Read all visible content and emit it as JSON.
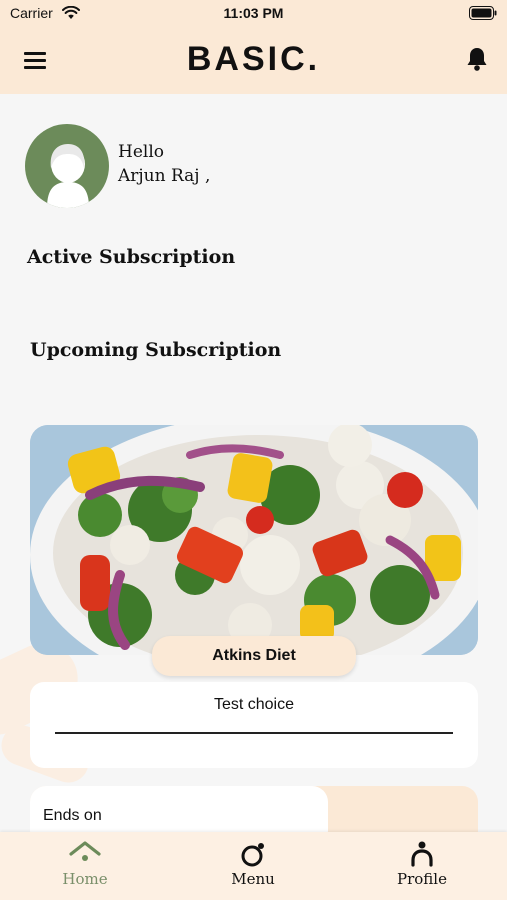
{
  "status_bar": {
    "carrier": "Carrier",
    "time": "11:03 PM"
  },
  "header": {
    "logo": "BASIC."
  },
  "greeting": {
    "hello": "Hello",
    "name": "Arjun Raj ,"
  },
  "sections": {
    "active": "Active Subscription",
    "upcoming": "Upcoming Subscription"
  },
  "subscription": {
    "diet_name": "Atkins Diet",
    "choice": "Test choice",
    "ends_label": "Ends on"
  },
  "tabs": [
    {
      "label": "Home",
      "icon": "home-icon",
      "active": true
    },
    {
      "label": "Menu",
      "icon": "menu-icon",
      "active": false
    },
    {
      "label": "Profile",
      "icon": "profile-icon",
      "active": false
    }
  ],
  "colors": {
    "accent_bg": "#fbe9d6",
    "active_tab": "#6c8b5a",
    "text": "#111111"
  }
}
